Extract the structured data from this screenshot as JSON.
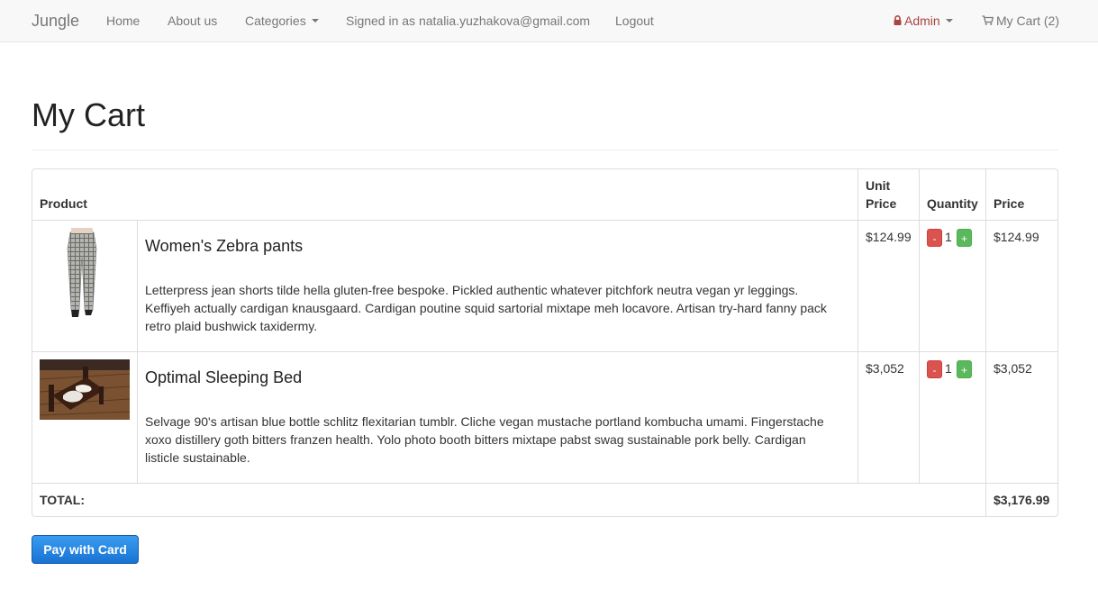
{
  "navbar": {
    "brand": "Jungle",
    "links": {
      "home": "Home",
      "about": "About us",
      "categories": "Categories",
      "signed_in": "Signed in as natalia.yuzhakova@gmail.com",
      "logout": "Logout"
    },
    "admin_label": "Admin",
    "cart_label": "My Cart (2)",
    "icons": {
      "admin": "lock-icon",
      "cart": "shopping-cart-icon"
    },
    "colors": {
      "admin": "#a94442",
      "link": "#777777",
      "background": "#f8f8f8"
    }
  },
  "page": {
    "title": "My Cart"
  },
  "table": {
    "headers": {
      "product": "Product",
      "unit_price_line1": "Unit",
      "unit_price_line2": "Price",
      "quantity": "Quantity",
      "price": "Price"
    },
    "rows": [
      {
        "name": "Women's Zebra pants",
        "description": "Letterpress jean shorts tilde hella gluten-free bespoke. Pickled authentic whatever pitchfork neutra vegan yr leggings. Keffiyeh actually cardigan knausgaard. Cardigan poutine squid sartorial mixtape meh locavore. Artisan try-hard fanny pack retro plaid bushwick taxidermy.",
        "unit_price": "$124.99",
        "quantity": "1",
        "price": "$124.99",
        "image": "pants-image"
      },
      {
        "name": "Optimal Sleeping Bed",
        "description": "Selvage 90's artisan blue bottle schlitz flexitarian tumblr. Cliche vegan mustache portland kombucha umami. Fingerstache xoxo distillery goth bitters franzen health. Yolo photo booth bitters mixtape pabst swag sustainable pork belly. Cardigan listicle sustainable.",
        "unit_price": "$3,052",
        "quantity": "1",
        "price": "$3,052",
        "image": "bed-image"
      }
    ],
    "qty_minus": "-",
    "qty_plus": "+",
    "total_label": "TOTAL:",
    "total_value": "$3,176.99",
    "colors": {
      "minus": "#d9534f",
      "plus": "#5cb85c"
    }
  },
  "pay_button": {
    "label": "Pay with Card",
    "color": "#1b7ad8"
  }
}
